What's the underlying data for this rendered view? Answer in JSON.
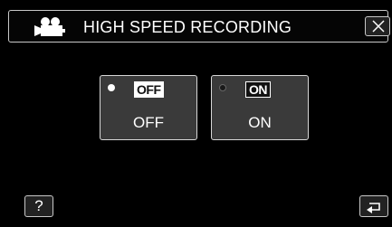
{
  "header": {
    "title": "HIGH SPEED RECORDING",
    "mode_icon": "video-camera-icon",
    "close_icon": "close-icon"
  },
  "options": [
    {
      "badge": "OFF",
      "label": "OFF",
      "selected": true
    },
    {
      "badge": "ON",
      "label": "ON",
      "selected": false
    }
  ],
  "footer": {
    "help_label": "?",
    "back_icon": "back-arrow-icon"
  },
  "colors": {
    "background": "#000000",
    "button_face": "#3a3a3a",
    "text": "#ffffff"
  }
}
